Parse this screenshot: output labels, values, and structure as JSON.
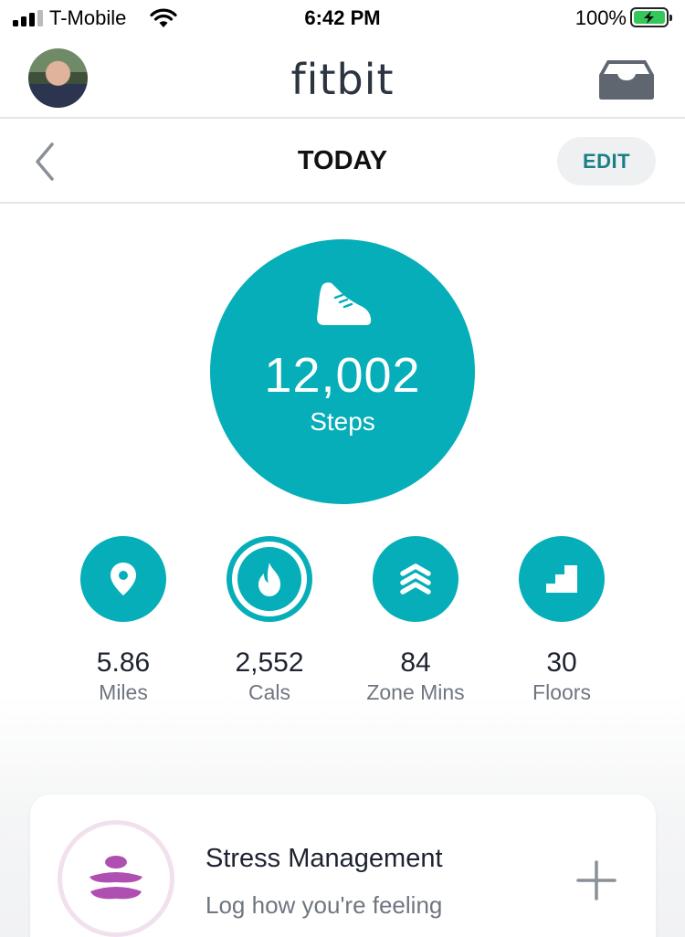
{
  "status_bar": {
    "carrier": "T-Mobile",
    "time": "6:42 PM",
    "battery": "100%"
  },
  "header": {
    "brand": "fitbit",
    "icons": {
      "avatar": "profile-photo",
      "inbox": "inbox-icon"
    }
  },
  "subheader": {
    "title": "TODAY",
    "edit_label": "EDIT",
    "back_icon": "chevron-left-icon"
  },
  "steps": {
    "value": "12,002",
    "label": "Steps",
    "icon": "shoe-icon"
  },
  "stats": [
    {
      "value": "5.86",
      "label": "Miles",
      "icon": "location-pin-icon"
    },
    {
      "value": "2,552",
      "label": "Cals",
      "icon": "flame-icon"
    },
    {
      "value": "84",
      "label": "Zone Mins",
      "icon": "chevrons-up-icon"
    },
    {
      "value": "30",
      "label": "Floors",
      "icon": "stairs-icon"
    }
  ],
  "stress_card": {
    "title": "Stress Management",
    "subtitle": "Log how you're feeling",
    "icon": "meditation-icon",
    "add_icon": "plus-icon"
  },
  "colors": {
    "accent": "#05aeb8",
    "edit_text": "#1a7f86",
    "stress_purple": "#b04fb2"
  }
}
